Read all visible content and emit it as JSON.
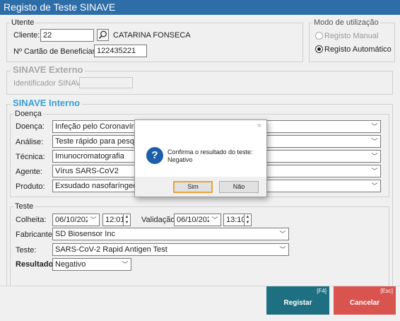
{
  "window": {
    "title": "Registo de Teste SINAVE"
  },
  "utente": {
    "group_label": "Utente",
    "cliente_label": "Cliente:",
    "cliente_value": "22",
    "cliente_name": "CATARINA FONSECA",
    "cartao_label": "Nº Cartão de Beneficiario:",
    "cartao_value": "122435221"
  },
  "modo": {
    "group_label": "Modo de utilização",
    "manual_label": "Registo Manual",
    "auto_label": "Registo Automático",
    "selected": "Registo Automático"
  },
  "externo": {
    "title": "SINAVE Externo",
    "id_label": "Identificador SINAVE:",
    "id_value": ""
  },
  "interno": {
    "title": "SINAVE Interno",
    "doenca_group": "Doença",
    "doenca_label": "Doença:",
    "doenca_value": "Infeção pelo Coronavírus",
    "analise_label": "Análise:",
    "analise_value": "Teste rápido para pesquisa",
    "tecnica_label": "Técnica:",
    "tecnica_value": "Imunocromatografia",
    "agente_label": "Agente:",
    "agente_value": "Vírus SARS-CoV2",
    "produto_label": "Produto:",
    "produto_value": "Exsudado nasofaríngeo"
  },
  "teste": {
    "group_label": "Teste",
    "colheita_label": "Colheita:",
    "colheita_date": "06/10/2021",
    "colheita_time": "12:01",
    "validacao_label": "Validação:",
    "validacao_date": "06/10/2021",
    "validacao_time": "13:10",
    "fabricante_label": "Fabricante:",
    "fabricante_value": "SD Biosensor Inc",
    "teste_label": "Teste:",
    "teste_value": "SARS-CoV-2 Rapid Antigen Test",
    "resultado_label": "Resultado:",
    "resultado_value": "Negativo"
  },
  "actions": {
    "registar_label": "Registar",
    "registar_key": "[F4]",
    "cancelar_label": "Cancelar",
    "cancelar_key": "[Esc]"
  },
  "dialog": {
    "close": "×",
    "icon": "?",
    "message_line1": "Confirma o resultado do teste:",
    "message_line2": "Negativo",
    "yes_label": "Sim",
    "no_label": "Não"
  },
  "icons": {
    "search": "search-icon",
    "dropdown": "chevron-down-icon",
    "question": "question-icon"
  },
  "colors": {
    "title_bar": "#2e6ea8",
    "section_title": "#3a9fd6",
    "registar": "#1f6f82",
    "cancelar": "#d9534f",
    "dialog_default_border": "#e8a33b"
  }
}
